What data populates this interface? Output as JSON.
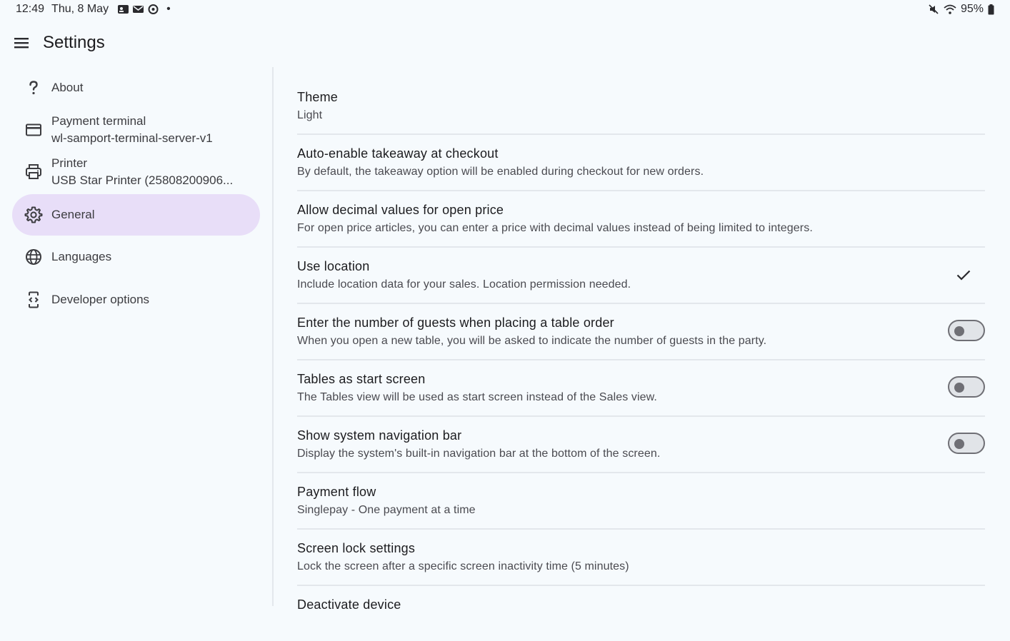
{
  "status_bar": {
    "time": "12:49",
    "date": "Thu, 8 May",
    "dot": "•",
    "battery": "95%"
  },
  "app_bar": {
    "title": "Settings"
  },
  "sidebar": {
    "items": [
      {
        "label": "About",
        "icon": "help-icon"
      },
      {
        "label": "Payment terminal",
        "sub": "wl-samport-terminal-server-v1",
        "icon": "credit-card-icon"
      },
      {
        "label": "Printer",
        "sub": "USB Star Printer (25808200906...",
        "icon": "printer-icon"
      },
      {
        "label": "General",
        "icon": "gear-icon",
        "active": true
      },
      {
        "label": "Languages",
        "icon": "globe-icon"
      },
      {
        "label": "Developer options",
        "icon": "developer-mode-icon"
      }
    ]
  },
  "settings": [
    {
      "title": "Theme",
      "summary": "Light"
    },
    {
      "title": "Auto-enable takeaway at checkout",
      "summary": "By default, the takeaway option will be enabled during checkout for new orders."
    },
    {
      "title": "Allow decimal values for open price",
      "summary": "For open price articles, you can enter a price with decimal values instead of being limited to integers."
    },
    {
      "title": "Use location",
      "summary": "Include location data for your sales. Location permission needed.",
      "control": "checkmark",
      "checked": true
    },
    {
      "title": "Enter the number of guests when placing a table order",
      "summary": "When you open a new table, you will be asked to indicate the number of guests in the party.",
      "control": "switch",
      "checked": false
    },
    {
      "title": "Tables as start screen",
      "summary": "The Tables view will be used as start screen instead of the Sales view.",
      "control": "switch",
      "checked": false
    },
    {
      "title": "Show system navigation bar",
      "summary": "Display the system's built-in navigation bar at the bottom of the screen.",
      "control": "switch",
      "checked": false
    },
    {
      "title": "Payment flow",
      "summary": "Singlepay - One payment at a time"
    },
    {
      "title": "Screen lock settings",
      "summary": "Lock the screen after a specific screen inactivity time (5 minutes)"
    },
    {
      "title": "Deactivate device",
      "summary": ""
    }
  ],
  "colors": {
    "background": "#f6fafd",
    "active_nav": "#e8def8",
    "divider": "#e3e7ec"
  }
}
